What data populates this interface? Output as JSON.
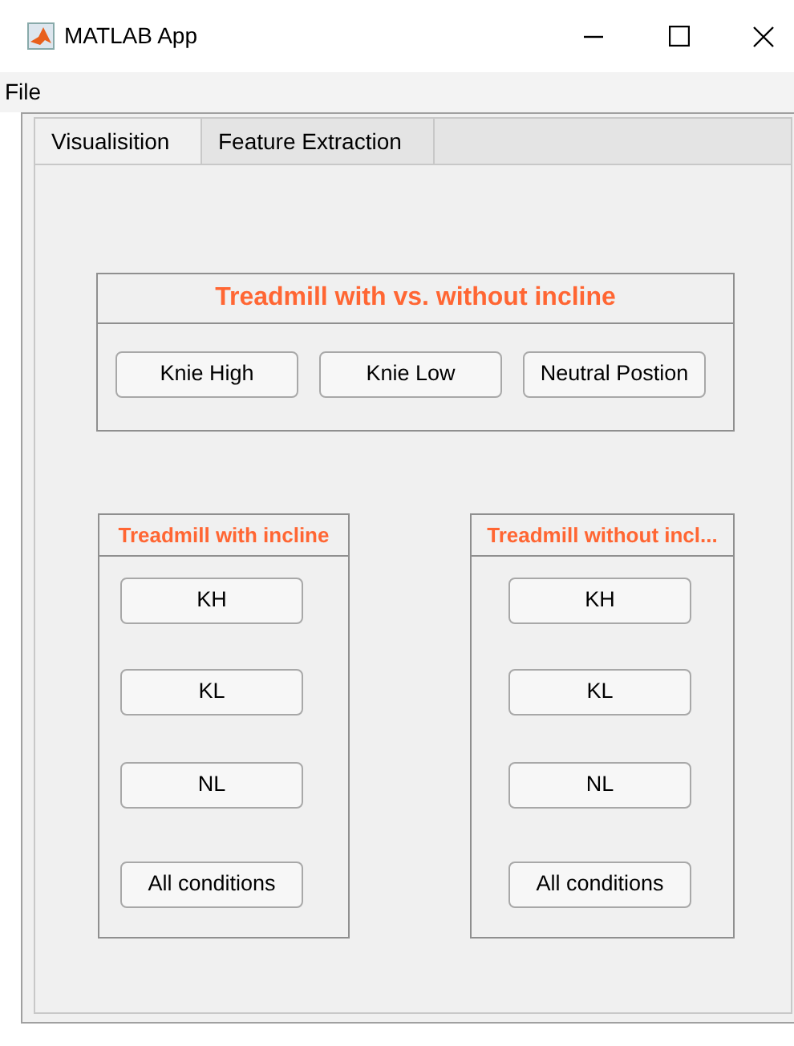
{
  "window": {
    "title": "MATLAB App"
  },
  "menu": [
    "File"
  ],
  "tabs": [
    {
      "label": "Visualisition",
      "selected": true
    },
    {
      "label": "Feature Extraction",
      "selected": false
    }
  ],
  "main_panel": {
    "title": "Treadmill with vs. without incline",
    "buttons": [
      "Knie High",
      "Knie Low",
      "Neutral Postion"
    ]
  },
  "side_panels": [
    {
      "title": "Treadmill with incline",
      "buttons": [
        "KH",
        "KL",
        "NL",
        "All conditions"
      ]
    },
    {
      "title": "Treadmill without incl...",
      "buttons": [
        "KH",
        "KL",
        "NL",
        "All conditions"
      ]
    }
  ]
}
